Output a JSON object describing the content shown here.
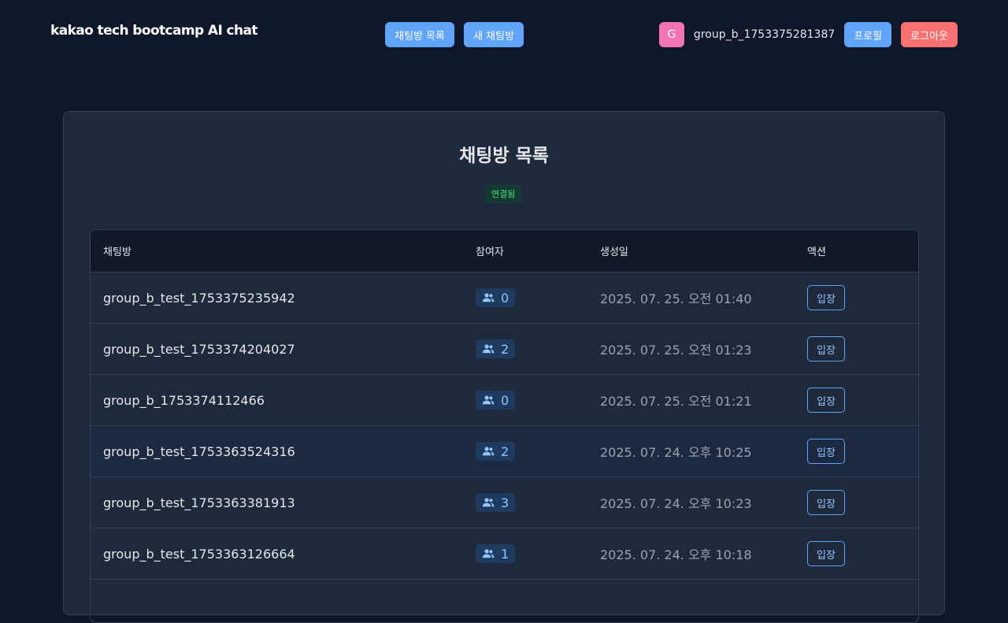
{
  "header": {
    "brand": "kakao tech bootcamp AI chat",
    "nav": {
      "rooms_label": "채팅방 목록",
      "new_room_label": "새 채팅방"
    },
    "user": {
      "avatar_initial": "G",
      "username": "group_b_1753375281387",
      "profile_label": "프로필",
      "logout_label": "로그아웃"
    }
  },
  "main": {
    "title": "채팅방 목록",
    "status": "연결됨",
    "table": {
      "headers": {
        "name": "채팅방",
        "participants": "참여자",
        "created": "생성일",
        "action": "액션"
      },
      "rows": [
        {
          "name": "group_b_test_1753375235942",
          "participants": "0",
          "created": "2025. 07. 25. 오전 01:40",
          "action": "입장"
        },
        {
          "name": "group_b_test_1753374204027",
          "participants": "2",
          "created": "2025. 07. 25. 오전 01:23",
          "action": "입장"
        },
        {
          "name": "group_b_1753374112466",
          "participants": "0",
          "created": "2025. 07. 25. 오전 01:21",
          "action": "입장"
        },
        {
          "name": "group_b_test_1753363524316",
          "participants": "2",
          "created": "2025. 07. 24. 오후 10:25",
          "action": "입장"
        },
        {
          "name": "group_b_test_1753363381913",
          "participants": "3",
          "created": "2025. 07. 24. 오후 10:23",
          "action": "입장"
        },
        {
          "name": "group_b_test_1753363126664",
          "participants": "1",
          "created": "2025. 07. 24. 오후 10:18",
          "action": "입장"
        }
      ]
    }
  },
  "colors": {
    "accent": "#60a5fa",
    "danger": "#f87171",
    "avatar": "#f472b6",
    "connected": "#4ade80",
    "background": "#0f172a"
  },
  "icons": {
    "participants": "users-icon"
  }
}
